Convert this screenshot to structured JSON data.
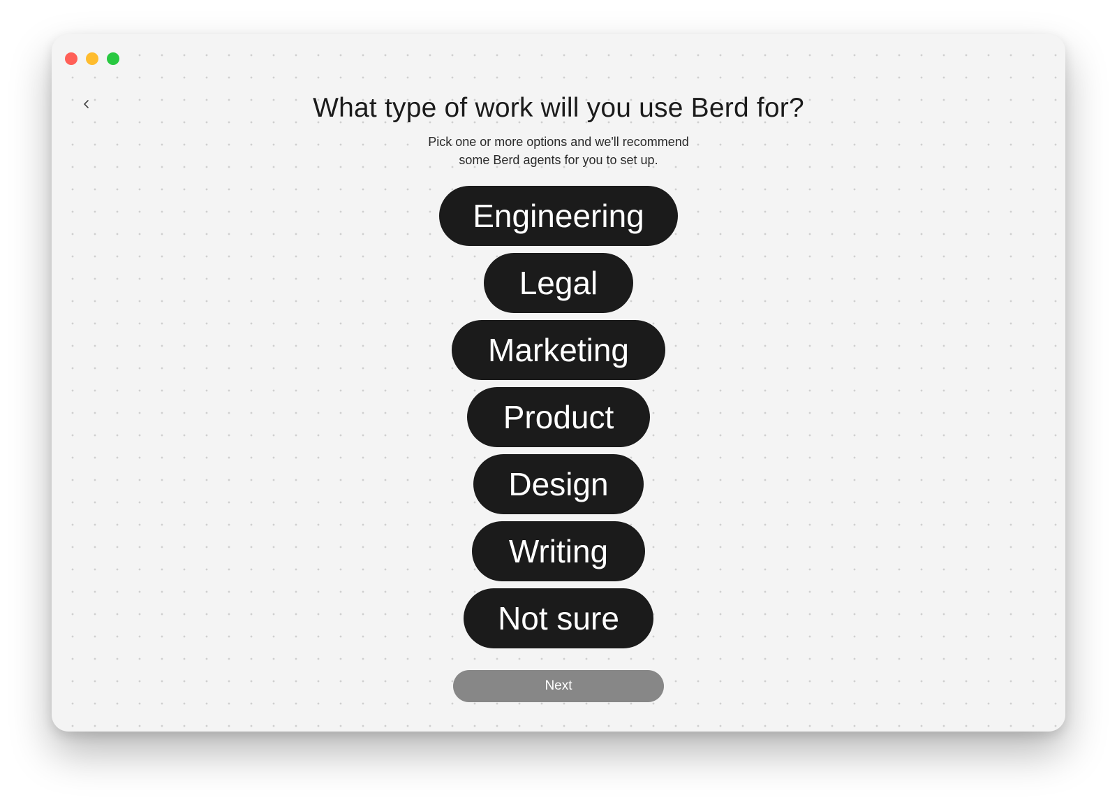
{
  "window": {
    "controls": [
      {
        "name": "close-button",
        "color": "#ff5f57"
      },
      {
        "name": "minimize-button",
        "color": "#febc2e"
      },
      {
        "name": "zoom-button",
        "color": "#28c840"
      }
    ]
  },
  "nav": {
    "back_icon": "chevron-left-icon"
  },
  "header": {
    "title": "What type of work will you use Berd for?",
    "subtitle_line1": "Pick one or more options and we'll recommend",
    "subtitle_line2": "some Berd agents for you to set up."
  },
  "options": [
    {
      "label": "Engineering",
      "selected": false
    },
    {
      "label": "Legal",
      "selected": false
    },
    {
      "label": "Marketing",
      "selected": false
    },
    {
      "label": "Product",
      "selected": false
    },
    {
      "label": "Design",
      "selected": false
    },
    {
      "label": "Writing",
      "selected": false
    },
    {
      "label": "Not sure",
      "selected": false
    }
  ],
  "footer": {
    "next_label": "Next",
    "next_enabled": false
  },
  "colors": {
    "background": "#f4f4f4",
    "pill": "#1b1b1b",
    "pill_text": "#ffffff",
    "next_disabled": "#878787"
  }
}
